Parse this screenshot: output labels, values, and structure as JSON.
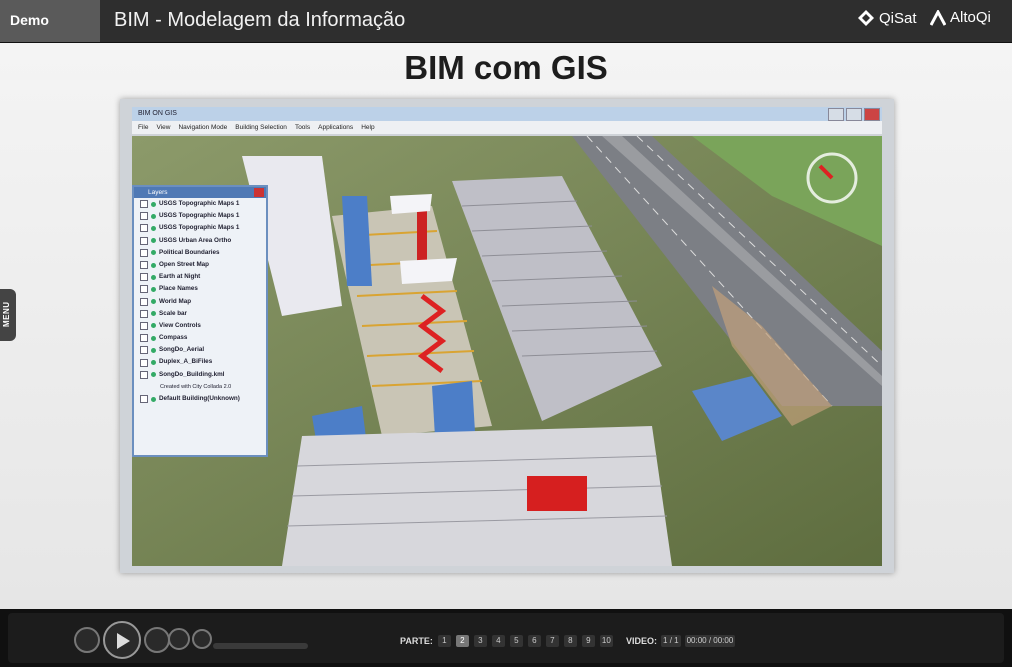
{
  "header": {
    "demo_label": "Demo",
    "title": "BIM - Modelagem da Informação",
    "brand_qisat": "QiSat",
    "brand_altoqi": "AltoQi"
  },
  "slide": {
    "title": "BIM com GIS",
    "menu_label": "MENU"
  },
  "window": {
    "title": "BIM ON GIS",
    "menu": [
      "File",
      "View",
      "Navigation Mode",
      "Building Selection",
      "Tools",
      "Applications",
      "Help"
    ]
  },
  "layers": {
    "title": "Layers",
    "items": [
      "USGS Topographic Maps 1",
      "USGS Topographic Maps 1",
      "USGS Topographic Maps 1",
      "USGS Urban Area Ortho",
      "Political Boundaries",
      "Open Street Map",
      "Earth at Night",
      "Place Names",
      "World Map",
      "Scale bar",
      "View Controls",
      "Compass",
      "SongDo_Aerial",
      "Duplex_A_BiFiles",
      "SongDo_Building.kml",
      "Default Building(Unknown)"
    ],
    "note": "Created with City Collada 2.0"
  },
  "controls": {
    "parte_label": "PARTE:",
    "parts": [
      "1",
      "2",
      "3",
      "4",
      "5",
      "6",
      "7",
      "8",
      "9",
      "10"
    ],
    "video_label": "VIDEO:",
    "video_counter": "1 / 1",
    "time": "00:00 / 00:00"
  }
}
